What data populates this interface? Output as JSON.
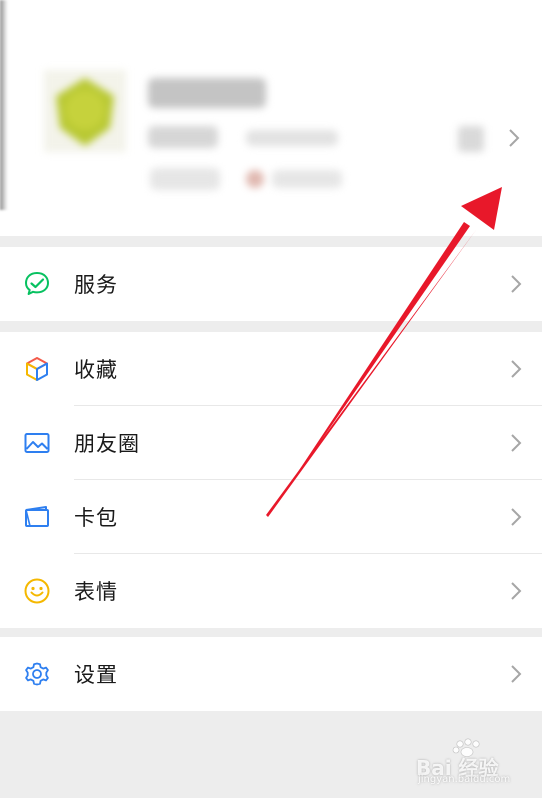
{
  "menu": {
    "services": "服务",
    "favorites": "收藏",
    "moments": "朋友圈",
    "cards": "卡包",
    "stickers": "表情",
    "settings": "设置"
  },
  "watermark": {
    "brand": "Bai 经验",
    "url": "jingyan.baidu.com"
  },
  "colors": {
    "accent_green": "#07c160",
    "arrow_red": "#e8182a",
    "moments_blue": "#2e7ff0",
    "sticker_yellow": "#f5b800"
  }
}
